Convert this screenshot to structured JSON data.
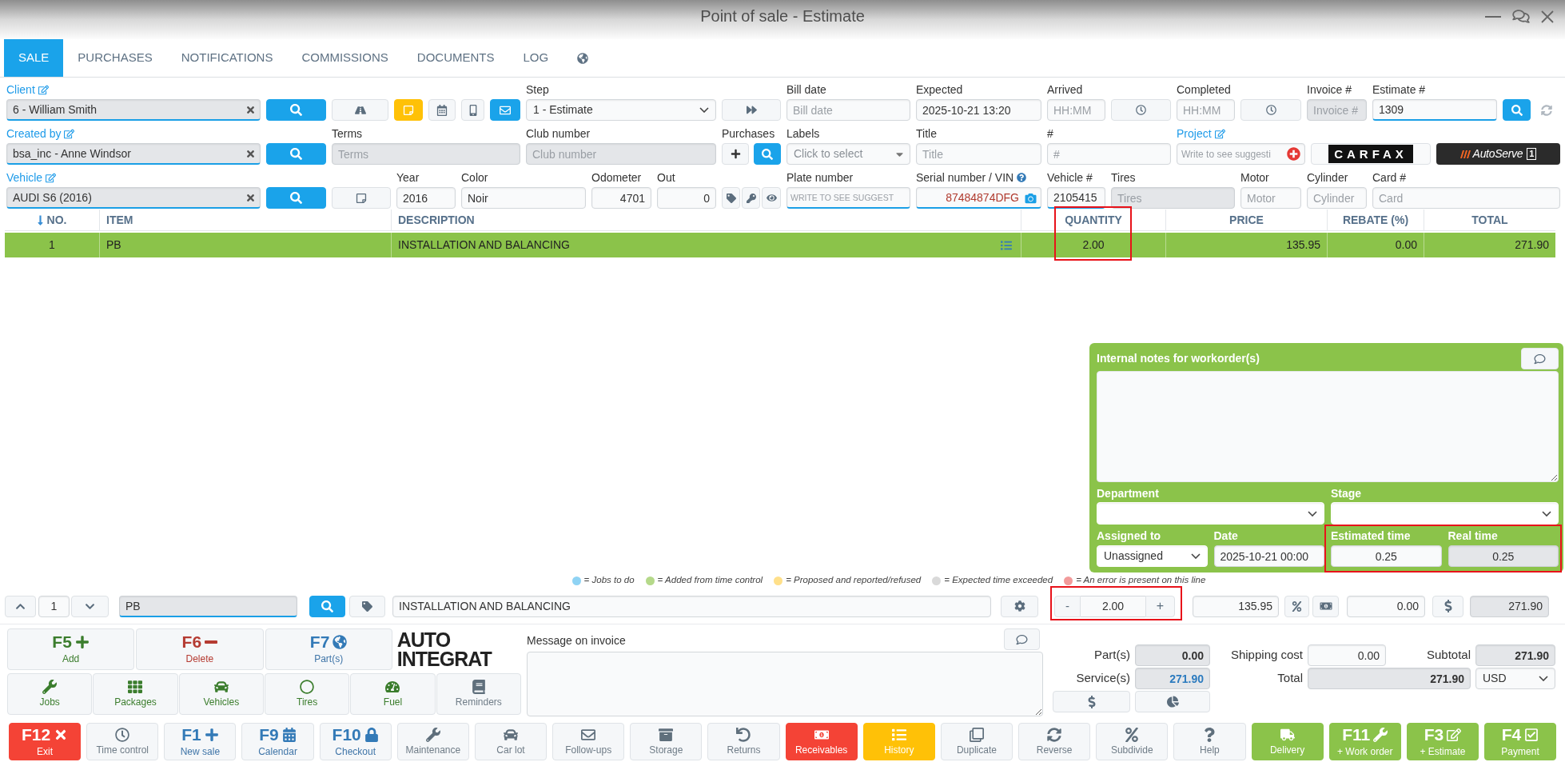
{
  "window": {
    "title": "Point of sale - Estimate"
  },
  "tabs": [
    {
      "kind": "text",
      "label": "SALE",
      "selected": true
    },
    {
      "kind": "text",
      "label": "PURCHASES",
      "selected": false
    },
    {
      "kind": "text",
      "label": "NOTIFICATIONS",
      "selected": false
    },
    {
      "kind": "text",
      "label": "COMMISSIONS",
      "selected": false
    },
    {
      "kind": "text",
      "label": "DOCUMENTS",
      "selected": false
    },
    {
      "kind": "text",
      "label": "LOG",
      "selected": false
    },
    {
      "kind": "globe",
      "selected": false
    }
  ],
  "form": {
    "client": {
      "label": "Client",
      "editable": true,
      "value": "6 - William Smith",
      "readonly": true
    },
    "created_by": {
      "label": "Created by",
      "editable": true,
      "value": "bsa_inc - Anne Windsor",
      "readonly": true
    },
    "vehicle": {
      "label": "Vehicle",
      "editable": true,
      "value": "AUDI S6 (2016)",
      "readonly": true
    },
    "client_actions": [
      {
        "active": false
      },
      {
        "active": true,
        "color": "#ffc107"
      },
      {
        "active": false
      },
      {
        "active": false
      },
      {
        "active": true,
        "color": "#1aa3ea"
      }
    ],
    "step": {
      "label": "Step",
      "value": "1 - Estimate"
    },
    "terms": {
      "label": "Terms",
      "placeholder": "Terms",
      "readonly": true
    },
    "club_number": {
      "label": "Club number",
      "placeholder": "Club number",
      "readonly": true
    },
    "purchases": {
      "label": "Purchases"
    },
    "year": {
      "label": "Year",
      "value": "2016"
    },
    "color": {
      "label": "Color",
      "value": "Noir"
    },
    "odometer": {
      "label": "Odometer",
      "value": "4701"
    },
    "out": {
      "label": "Out",
      "value": "0"
    },
    "bill_date": {
      "label": "Bill date",
      "placeholder": "Bill date"
    },
    "expected": {
      "label": "Expected",
      "value": "2025-10-21 13:20"
    },
    "arrived": {
      "label": "Arrived",
      "placeholder": "HH:MM"
    },
    "completed": {
      "label": "Completed",
      "placeholder": "HH:MM"
    },
    "invoice_number": {
      "label": "Invoice #",
      "placeholder": "Invoice #",
      "readonly": true
    },
    "estimate_number": {
      "label": "Estimate #",
      "value": "1309"
    },
    "labels": {
      "label": "Labels",
      "placeholder": "Click to select"
    },
    "title": {
      "label": "Title",
      "placeholder": "Title"
    },
    "number": {
      "label": "#",
      "placeholder": "#"
    },
    "project": {
      "label": "Project",
      "editable": true,
      "placeholder": "Write to see suggesti"
    },
    "plate_number": {
      "label": "Plate number",
      "placeholder": "WRITE TO SEE SUGGEST"
    },
    "serial_vin": {
      "label": "Serial number / VIN",
      "value": "87484874DFG"
    },
    "vehicle_number": {
      "label": "Vehicle #",
      "value": "2105415"
    },
    "tires": {
      "label": "Tires",
      "placeholder": "Tires",
      "readonly": true
    },
    "motor": {
      "label": "Motor",
      "placeholder": "Motor"
    },
    "cylinder": {
      "label": "Cylinder",
      "placeholder": "Cylinder"
    },
    "card": {
      "label": "Card #",
      "placeholder": "Card"
    }
  },
  "logos": {
    "carfax": "CARFAX",
    "autoserve": {
      "name": "AutoServe",
      "badge": "1"
    }
  },
  "table": {
    "columns": [
      {
        "label": "NO.",
        "sorted": true
      },
      {
        "label": "ITEM",
        "sorted": false
      },
      {
        "label": "DESCRIPTION",
        "sorted": false
      },
      {
        "label": "QUANTITY",
        "sorted": false
      },
      {
        "label": "PRICE",
        "sorted": false
      },
      {
        "label": "REBATE (%)",
        "sorted": false
      },
      {
        "label": "TOTAL",
        "sorted": false
      }
    ],
    "rows": [
      {
        "selected": true,
        "cells": [
          "1",
          "PB",
          "INSTALLATION AND BALANCING",
          "2.00",
          "135.95",
          "0.00",
          "271.90"
        ]
      }
    ]
  },
  "workorder_notes": {
    "title": "Internal notes for workorder(s)",
    "department": {
      "label": "Department"
    },
    "stage": {
      "label": "Stage"
    },
    "assigned_to": {
      "label": "Assigned to",
      "value": "Unassigned"
    },
    "date": {
      "label": "Date",
      "value": "2025-10-21 00:00"
    },
    "estimated_time": {
      "label": "Estimated time",
      "value": "0.25"
    },
    "real_time": {
      "label": "Real time",
      "value": "0.25",
      "readonly": true
    }
  },
  "legend": [
    {
      "color": "#8fd3f4",
      "text": "= Jobs to do"
    },
    {
      "color": "#b5d98a",
      "text": "= Added from time control"
    },
    {
      "color": "#ffe08a",
      "text": "= Proposed and reported/refused"
    },
    {
      "color": "#d9d9d9",
      "text": "= Expected time exceeded"
    },
    {
      "color": "#f29b9b",
      "text": "= An error is present on this line"
    }
  ],
  "line_editor": {
    "index": {
      "value": "1"
    },
    "item": {
      "value": "PB",
      "readonly": true
    },
    "description": {
      "value": "INSTALLATION AND BALANCING"
    },
    "decrement": "-",
    "quantity": {
      "value": "2.00"
    },
    "increment": "+",
    "price": {
      "value": "135.95"
    },
    "rebate": {
      "value": "0.00"
    },
    "total": {
      "value": "271.90",
      "readonly": true
    }
  },
  "shortcuts": [
    {
      "key": "F5",
      "label": "Add",
      "kind": "positive"
    },
    {
      "key": "F6",
      "label": "Delete",
      "kind": "negative"
    },
    {
      "key": "F7",
      "label": "Part(s)",
      "kind": "link"
    }
  ],
  "partner_logo": [
    "AUTO",
    "INTEGRAT"
  ],
  "catalog_buttons": [
    {
      "label": "Jobs",
      "kind": "positive"
    },
    {
      "label": "Packages",
      "kind": "positive"
    },
    {
      "label": "Vehicles",
      "kind": "positive"
    },
    {
      "label": "Tires",
      "kind": "positive"
    },
    {
      "label": "Fuel",
      "kind": "positive"
    },
    {
      "label": "Reminders",
      "kind": "plain"
    }
  ],
  "invoice_message": {
    "label": "Message on invoice"
  },
  "totals": {
    "parts": {
      "label": "Part(s)",
      "value": "0.00",
      "readonly": true
    },
    "services": {
      "label": "Service(s)",
      "value": "271.90",
      "readonly": true
    },
    "shipping": {
      "label": "Shipping cost",
      "value": "0.00"
    },
    "subtotal": {
      "label": "Subtotal",
      "value": "271.90",
      "readonly": true
    },
    "total": {
      "label": "Total",
      "value": "271.90",
      "readonly": true
    },
    "currency": {
      "value": "USD"
    }
  },
  "actions": [
    {
      "key": "F12",
      "label": "Exit",
      "kind": "alert"
    },
    {
      "label": "Time control",
      "kind": "plain"
    },
    {
      "key": "F1",
      "label": "New sale",
      "kind": "link"
    },
    {
      "key": "F9",
      "label": "Calendar",
      "kind": "link"
    },
    {
      "key": "F10",
      "label": "Checkout",
      "kind": "link"
    },
    {
      "label": "Maintenance",
      "kind": "plain"
    },
    {
      "label": "Car lot",
      "kind": "plain"
    },
    {
      "label": "Follow-ups",
      "kind": "plain"
    },
    {
      "label": "Storage",
      "kind": "plain"
    },
    {
      "label": "Returns",
      "kind": "plain"
    },
    {
      "label": "Receivables",
      "kind": "alert"
    },
    {
      "label": "History",
      "kind": "caution"
    },
    {
      "label": "Duplicate",
      "kind": "plain"
    },
    {
      "label": "Reverse",
      "kind": "plain"
    },
    {
      "label": "Subdivide",
      "kind": "plain"
    },
    {
      "label": "Help",
      "kind": "plain"
    },
    {
      "label": "Delivery",
      "kind": "confirm"
    },
    {
      "key": "F11",
      "label": "+ Work order",
      "kind": "confirm"
    },
    {
      "key": "F3",
      "label": "+ Estimate",
      "kind": "confirm"
    },
    {
      "key": "F4",
      "label": "Payment",
      "kind": "confirm"
    }
  ]
}
